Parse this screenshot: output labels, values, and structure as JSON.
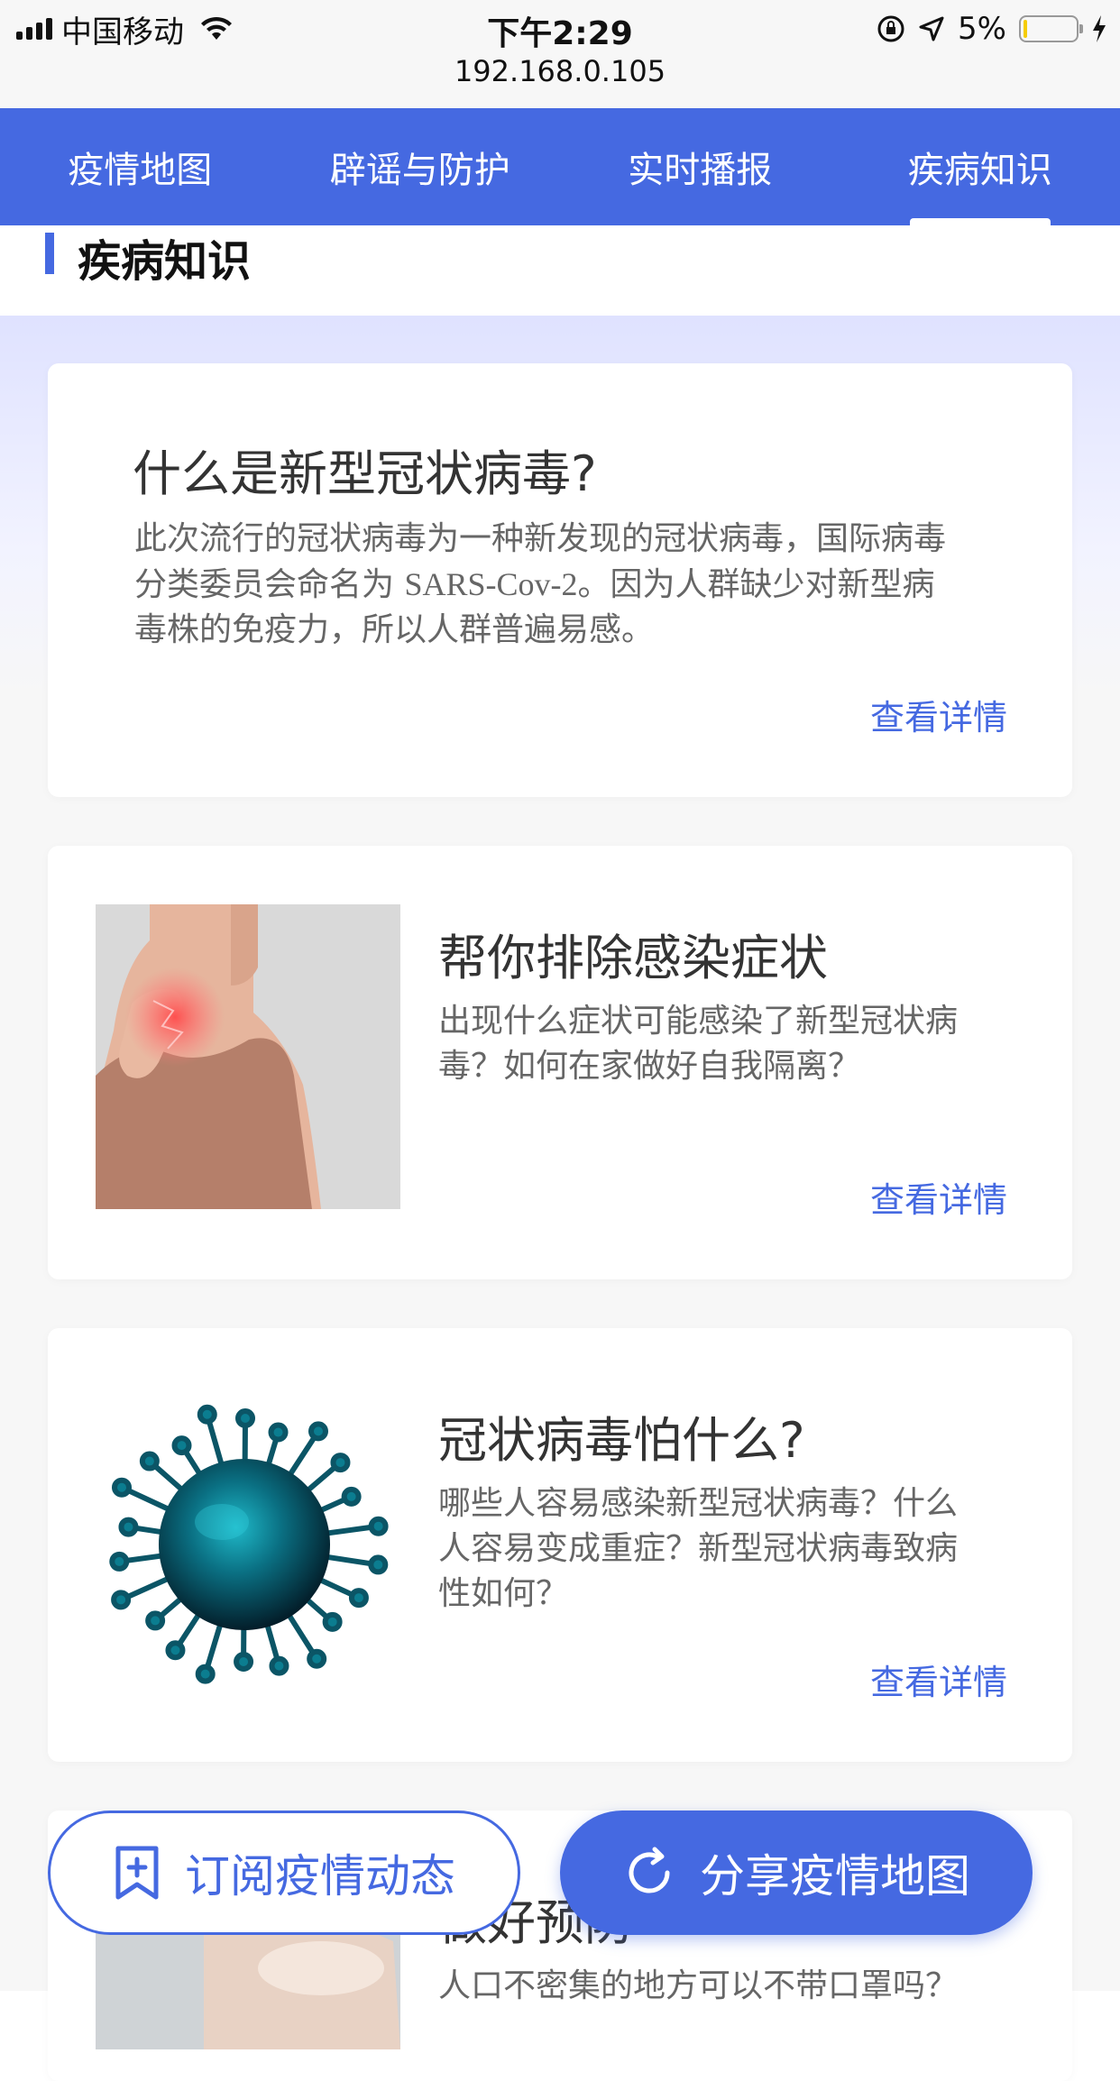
{
  "status_bar": {
    "carrier": "中国移动",
    "time": "下午2:29",
    "url": "192.168.0.105",
    "battery_percent": "5%",
    "battery_level": 0.05
  },
  "tabs": [
    {
      "label": "疫情地图",
      "active": false
    },
    {
      "label": "辟谣与防护",
      "active": false
    },
    {
      "label": "实时播报",
      "active": false
    },
    {
      "label": "疾病知识",
      "active": true
    }
  ],
  "section": {
    "title": "疾病知识"
  },
  "cards": [
    {
      "title": "什么是新型冠状病毒?",
      "desc_lines": [
        "此次流行的冠状病毒为一种新发现的冠状病毒，国际病毒",
        [
          "分类委员会命名为 ",
          "SARS-Cov-2",
          "。因为人群缺少对新型病"
        ],
        "毒株的免疫力，所以人群普遍易感。"
      ],
      "link": "查看详情"
    },
    {
      "title": "帮你排除感染症状",
      "desc_lines": [
        "出现什么症状可能感染了新型冠状病",
        "毒？如何在家做好自我隔离？"
      ],
      "link": "查看详情",
      "image": "woman-sore-throat-photo"
    },
    {
      "title": "冠状病毒怕什么?",
      "desc_lines": [
        "哪些人容易感染新型冠状病毒？什么",
        "人容易变成重症？新型冠状病毒致病",
        "性如何？"
      ],
      "link": "查看详情",
      "image": "coronavirus-illustration"
    },
    {
      "title": "做好预防",
      "desc_lines": [
        "人口不密集的地方可以不带口罩吗？"
      ],
      "image": "hand-washing-photo"
    }
  ],
  "buttons": {
    "subscribe": "订阅疫情动态",
    "share": "分享疫情地图"
  },
  "colors": {
    "primary": "#4569e1",
    "link": "#4569e1"
  }
}
